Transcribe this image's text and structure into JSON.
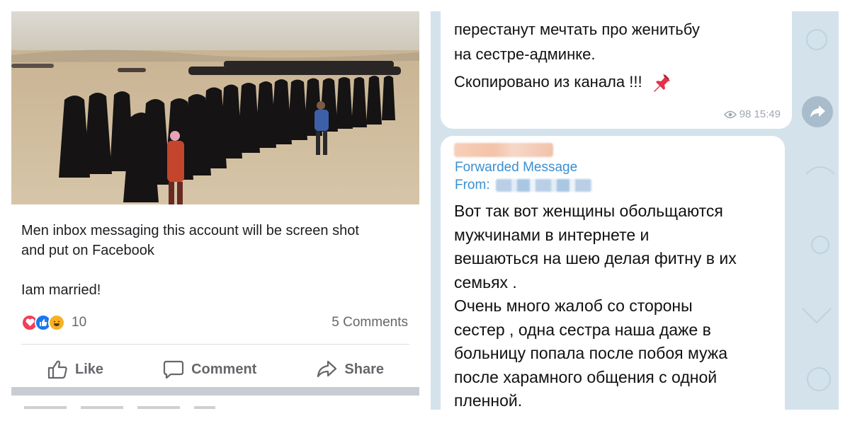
{
  "facebook_post": {
    "photo_icon": "photo-crowd-of-women-in-black",
    "text_line1": "Men inbox messaging this account will be screen shot\nand put on Facebook",
    "text_line2": "Iam married!",
    "reaction_icons": [
      "love-icon",
      "like-icon",
      "haha-icon"
    ],
    "reaction_count": "10",
    "comments": "5 Comments",
    "actions": {
      "like": "Like",
      "comment": "Comment",
      "share": "Share"
    }
  },
  "telegram": {
    "message1": {
      "text": "перестанут мечтать про женитьбу\nна сестре-админке.",
      "copy_line": "Скопировано из канала !!!",
      "views": "98",
      "time": "15:49"
    },
    "message2": {
      "forwarded_label": "Forwarded Message",
      "from_label": "From:",
      "body": "Вот так вот женщины обольщаются\nмужчинами в интернете и\nвешаються на шею делая фитну в их\nсемьях .\nОчень много жалоб со стороны\nсестер , одна сестра наша даже в\nбольницу попала после побоя мужа\nпосле харамного общения с одной\nпленной."
    },
    "colors": {
      "background": "#d4e2ec",
      "link_blue": "#3a8fd0",
      "meta_gray": "#a0a8b0"
    }
  },
  "colors": {
    "fb_text": "#1c1e21",
    "fb_muted": "#65676b",
    "love": "#f33e58",
    "like": "#1877f2",
    "haha": "#f7b125"
  }
}
